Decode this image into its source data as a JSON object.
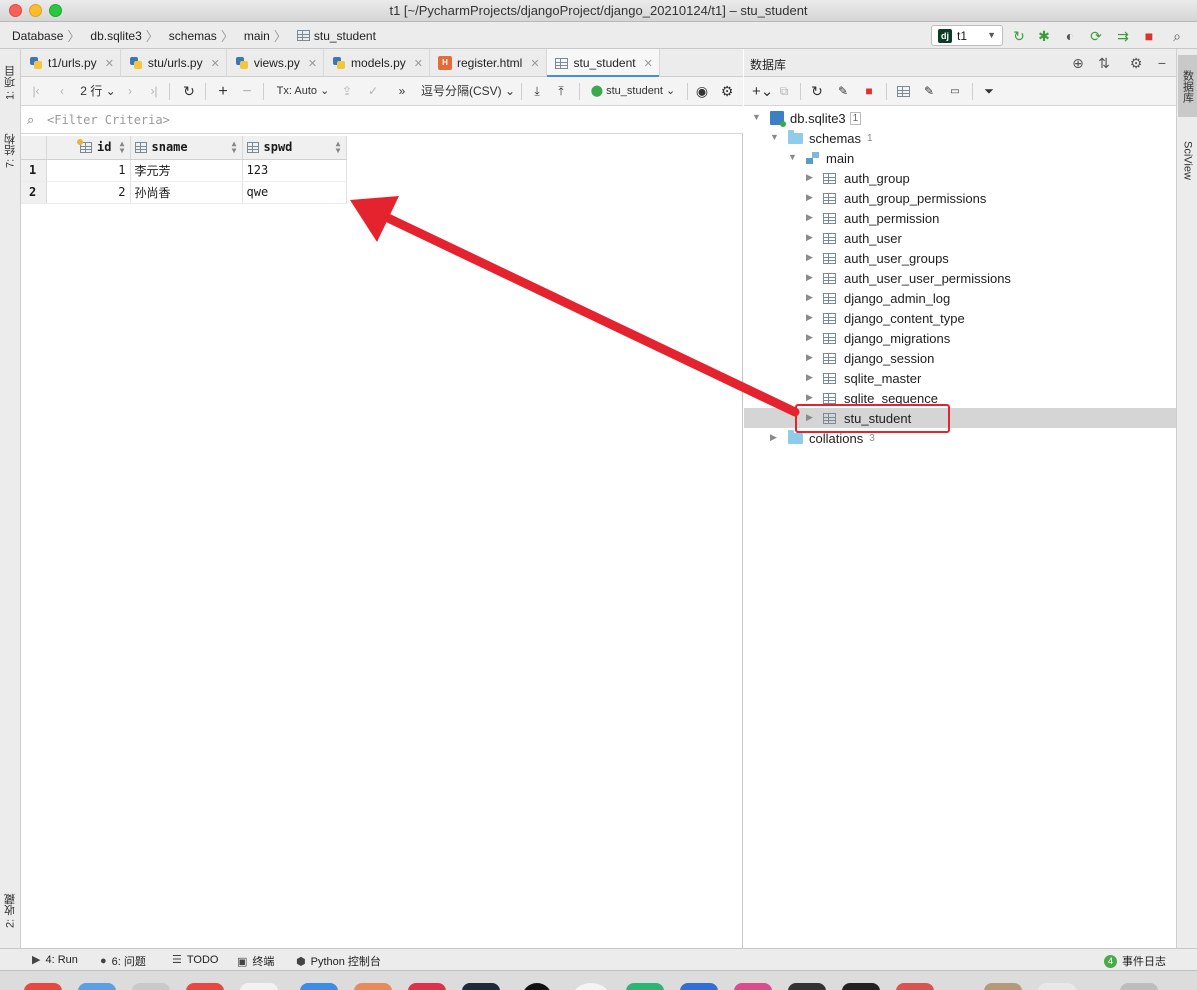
{
  "window": {
    "title": "t1 [~/PycharmProjects/djangoProject/django_20210124/t1] – stu_student"
  },
  "breadcrumb": [
    "Database",
    "db.sqlite3",
    "schemas",
    "main",
    "stu_student"
  ],
  "run_config": {
    "label": "t1",
    "icon_text": "dj"
  },
  "left_strip": {
    "project": "1: 项目",
    "structure": "7: 结构",
    "favorites": "2: 收藏"
  },
  "right_strip": {
    "database": "数据库",
    "sciview": "SciView"
  },
  "editor_tabs": [
    {
      "label": "t1/urls.py",
      "type": "python"
    },
    {
      "label": "stu/urls.py",
      "type": "python"
    },
    {
      "label": "views.py",
      "type": "python"
    },
    {
      "label": "models.py",
      "type": "python"
    },
    {
      "label": "register.html",
      "type": "html"
    },
    {
      "label": "stu_student",
      "type": "table",
      "active": true
    }
  ],
  "data_toolbar": {
    "rows": "2 行",
    "tx": "Tx: Auto",
    "export_format": "逗号分隔(CSV)",
    "table": "stu_student"
  },
  "filter": {
    "placeholder": "<Filter Criteria>"
  },
  "table": {
    "columns": [
      "id",
      "sname",
      "spwd"
    ],
    "rows": [
      {
        "num": "1",
        "id": "1",
        "sname": "李元芳",
        "spwd": "123"
      },
      {
        "num": "2",
        "id": "2",
        "sname": "孙尚香",
        "spwd": "qwe"
      }
    ]
  },
  "db_panel": {
    "title": "数据库",
    "root": {
      "label": "db.sqlite3",
      "count": "1"
    },
    "schemas": {
      "label": "schemas",
      "count": "1"
    },
    "main": {
      "label": "main"
    },
    "tables": [
      "auth_group",
      "auth_group_permissions",
      "auth_permission",
      "auth_user",
      "auth_user_groups",
      "auth_user_user_permissions",
      "django_admin_log",
      "django_content_type",
      "django_migrations",
      "django_session",
      "sqlite_master",
      "sqlite_sequence",
      "stu_student"
    ],
    "selected_table": "stu_student",
    "collations": {
      "label": "collations",
      "count": "3"
    }
  },
  "bottom_bar": {
    "run": "4: Run",
    "problems": "6: 问题",
    "todo": "TODO",
    "terminal": "终端",
    "python_console": "Python 控制台",
    "event_log": "事件日志",
    "event_count": "4"
  },
  "colors": {
    "accent": "#4a8dd9",
    "annotation_red": "#e5232e",
    "selection": "#d5d5d5"
  }
}
